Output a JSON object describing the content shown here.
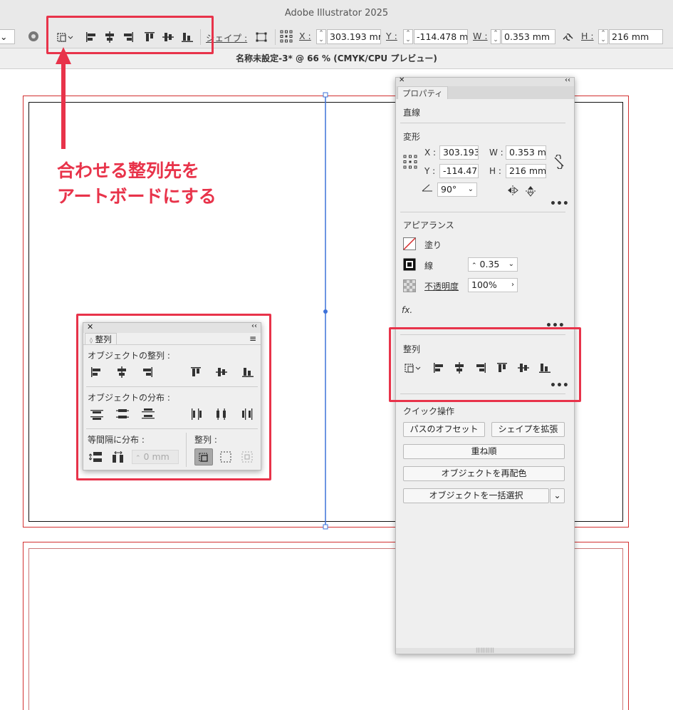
{
  "app": {
    "title": "Adobe Illustrator 2025"
  },
  "control_bar": {
    "shape_label": "シェイプ :",
    "x_label": "X :",
    "x_value": "303.193 mr",
    "y_label": "Y :",
    "y_value": "-114.478 m",
    "w_label": "W :",
    "w_value": "0.353 mm",
    "h_label": "H :",
    "h_value": "216 mm"
  },
  "document": {
    "tab_title": "名称未設定-3* @ 66 % (CMYK/CPU プレビュー)"
  },
  "annotation": {
    "line1": "合わせる整列先を",
    "line2": "アートボードにする",
    "color": "#e8334a"
  },
  "align_panel": {
    "tab": "整列",
    "objects_align_label": "オブジェクトの整列 :",
    "objects_distribute_label": "オブジェクトの分布 :",
    "spacing_label": "等間隔に分布 :",
    "align_to_label": "整列 :",
    "spacing_value_placeholder": "0 mm"
  },
  "properties_panel": {
    "tab": "プロパティ",
    "object_type": "直線",
    "transform": {
      "label": "変形",
      "x_label": "X :",
      "x_value": "303.193",
      "y_label": "Y :",
      "y_value": "-114.47",
      "w_label": "W :",
      "w_value": "0.353 m",
      "h_label": "H :",
      "h_value": "216 mm",
      "angle_value": "90°"
    },
    "appearance": {
      "label": "アピアランス",
      "fill_label": "塗り",
      "stroke_label": "線",
      "stroke_value": "0.35",
      "opacity_label": "不透明度",
      "opacity_value": "100%",
      "fx_label": "fx."
    },
    "align": {
      "label": "整列"
    },
    "quick_actions": {
      "label": "クイック操作",
      "offset_path": "パスのオフセット",
      "expand_shape": "シェイプを拡張",
      "arrange": "重ね順",
      "recolor": "オブジェクトを再配色",
      "select_same": "オブジェクトを一括選択"
    }
  },
  "colors": {
    "selection": "#3d72d9",
    "artboard_bleed": "#d23030",
    "highlight": "#e8334a"
  }
}
